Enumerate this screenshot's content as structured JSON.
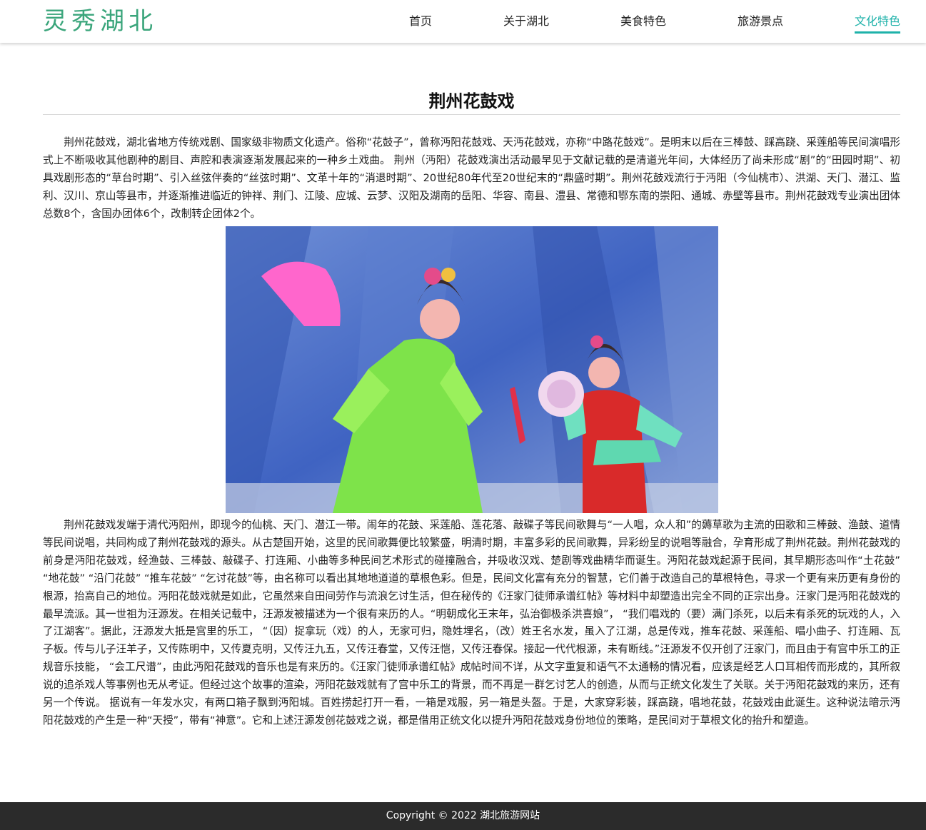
{
  "site": {
    "logo": "灵秀湖北"
  },
  "nav": {
    "items": [
      "首页",
      "关于湖北",
      "美食特色",
      "旅游景点",
      "文化特色"
    ],
    "active_index": 4,
    "active_color": "#1fb2aa"
  },
  "article": {
    "title": "荆州花鼓戏",
    "paragraphs": [
      "荆州花鼓戏，湖北省地方传统戏剧、国家级非物质文化遗产。俗称“花鼓子”，曾称沔阳花鼓戏、天沔花鼓戏，亦称“中路花鼓戏”。是明末以后在三棒鼓、踩高跷、采莲船等民间演唱形式上不断吸收其他剧种的剧目、声腔和表演逐渐发展起来的一种乡土戏曲。 荆州（沔阳）花鼓戏演出活动最早见于文献记载的是清道光年间，大体经历了尚未形成“剧”的“田园时期”、初具戏剧形态的“草台时期”、引入丝弦伴奏的“丝弦时期”、文革十年的“消退时期”、20世纪80年代至20世纪末的“鼎盛时期”。荆州花鼓戏流行于沔阳（今仙桃市）、洪湖、天门、潜江、监利、汉川、京山等县市，并逐渐推进临近的钟祥、荆门、江陵、应城、云梦、汉阳及湖南的岳阳、华容、南县、澧县、常德和鄂东南的崇阳、通城、赤壁等县市。荆州花鼓戏专业演出团体总数8个，含国办团体6个，改制转企团体2个。",
      "荆州花鼓戏发端于清代沔阳州，即现今的仙桃、天门、潜江一带。闹年的花鼓、采莲船、莲花落、敲碟子等民间歌舞与“一人唱，众人和”的薅草歌为主流的田歌和三棒鼓、渔鼓、道情等民间说唱，共同构成了荆州花鼓戏的源头。从古楚国开始，这里的民间歌舞便比较繁盛，明清时期，丰富多彩的民间歌舞，异彩纷呈的说唱等融合，孕育形成了荆州花鼓。荆州花鼓戏的前身是沔阳花鼓戏，经渔鼓、三棒鼓、敲碟子、打连厢、小曲等多种民间艺术形式的碰撞融合，并吸收汉戏、楚剧等戏曲精华而诞生。沔阳花鼓戏起源于民间，其早期形态叫作“土花鼓” “地花鼓” “沿门花鼓” “推车花鼓” “乞讨花鼓”等，由名称可以看出其地地道道的草根色彩。但是，民间文化富有充分的智慧，它们善于改造自己的草根特色，寻求一个更有来历更有身份的根源，抬高自己的地位。沔阳花鼓戏就是如此，它虽然来自田间劳作与流浪乞讨生活，但在秘传的《汪家门徒师承谱红帖》等材料中却塑造出完全不同的正宗出身。汪家门是沔阳花鼓戏的最早流派。其一世祖为汪源发。在相关记载中，汪源发被描述为一个很有来历的人。“明朝成化王末年，弘治御极杀洪喜娘”， “我们唱戏的（要）满门杀死，以后未有杀死的玩戏的人，入了江湖客”。据此，汪源发大抵是宫里的乐工， “（因）捉拿玩（戏）的人，无家可归，隐姓埋名，（改）姓王名水发，虽入了江湖，总是传戏，推车花鼓、采莲船、唱小曲子、打连厢、瓦子板。传与儿子汪羊子，又传陈明中，又传夏克明，又传汪九五，又传汪春堂，又传汪恺，又传汪春保。接起一代代根源，未有断线。”汪源发不仅开创了汪家门，而且由于有宫中乐工的正规音乐技能， “会工尺谱”，由此沔阳花鼓戏的音乐也是有来历的。《汪家门徒师承谱红帖》成帖时间不详，从文字重复和语气不太通畅的情况看，应该是经艺人口耳相传而形成的，其所叙说的追杀戏人等事例也无从考证。但经过这个故事的渲染，沔阳花鼓戏就有了宫中乐工的背景，而不再是一群乞讨艺人的创造，从而与正统文化发生了关联。关于沔阳花鼓戏的来历，还有另一个传说。 据说有一年发水灾，有两口箱子飘到沔阳城。百姓捞起打开一看，一箱是戏服，另一箱是头盔。于是，大家穿彩装，踩高跷，唱地花鼓，花鼓戏由此诞生。这种说法暗示沔阳花鼓戏的产生是一种“天授”，带有“神意”。它和上述汪源发创花鼓戏之说，都是借用正统文化以提升沔阳花鼓戏身份地位的策略，是民间对于草根文化的抬升和塑造。"
    ]
  },
  "footer": {
    "copyright": "Copyright © 2022 湖北旅游网站"
  },
  "colors": {
    "logo": "#3aa57b",
    "accent": "#1fb2aa",
    "footer_bg": "#2b2b2b"
  }
}
